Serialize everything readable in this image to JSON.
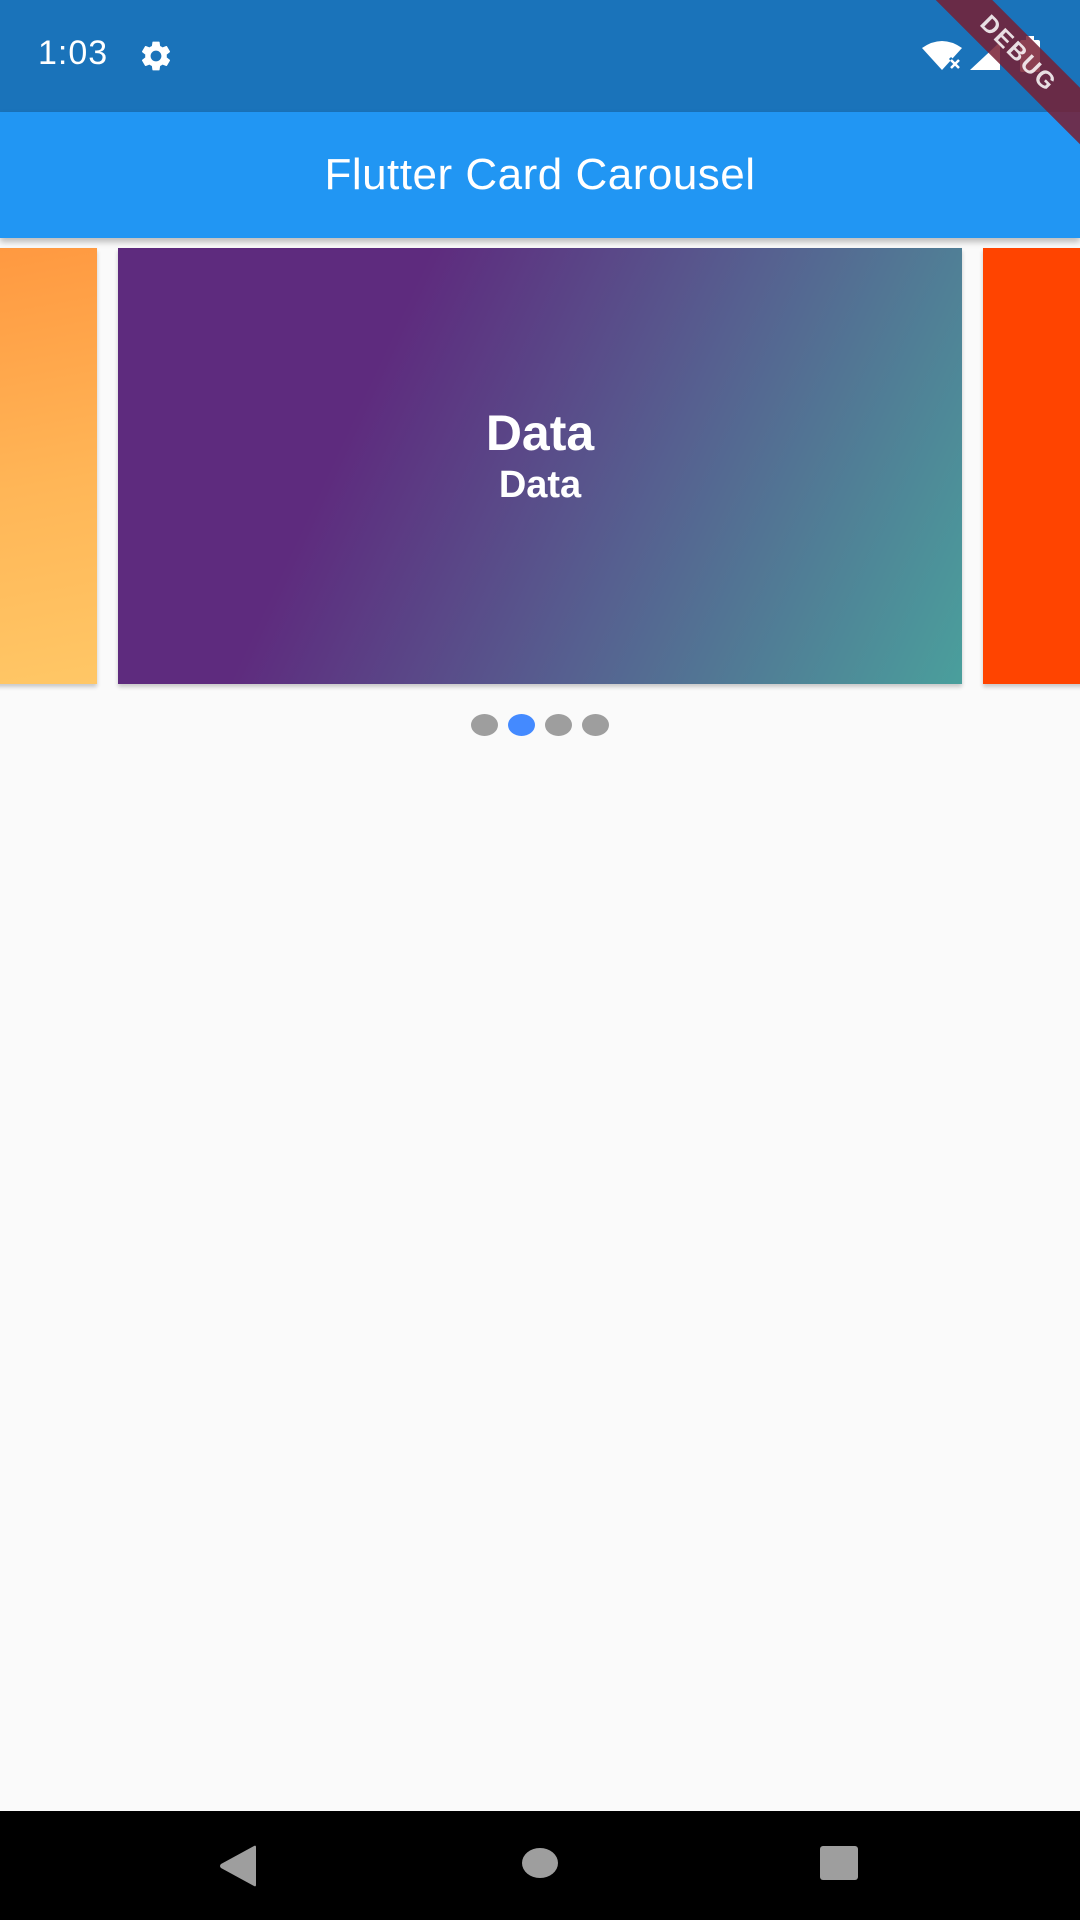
{
  "status_bar": {
    "time": "1:03",
    "icons": [
      "gear-icon",
      "wifi-icon",
      "signal-icon",
      "battery-icon"
    ]
  },
  "debug_banner": "DEBUG",
  "app_bar": {
    "title": "Flutter Card Carousel"
  },
  "carousel": {
    "current_card": {
      "title": "Data",
      "subtitle": "Data"
    },
    "colors": {
      "prev_card": "#ffa64a",
      "current_card_start": "#5e2b7e",
      "current_card_end": "#4a9f9c",
      "next_card": "#ff4400"
    },
    "indicator": {
      "count": 4,
      "active_index": 1,
      "active_color": "#448aff",
      "inactive_color": "#9e9e9e"
    }
  },
  "theme": {
    "status_bar_color": "#1a73ba",
    "app_bar_color": "#2196f3",
    "background": "#fafafa"
  },
  "nav_bar": {
    "icons": [
      "back-icon",
      "home-icon",
      "recents-icon"
    ]
  }
}
